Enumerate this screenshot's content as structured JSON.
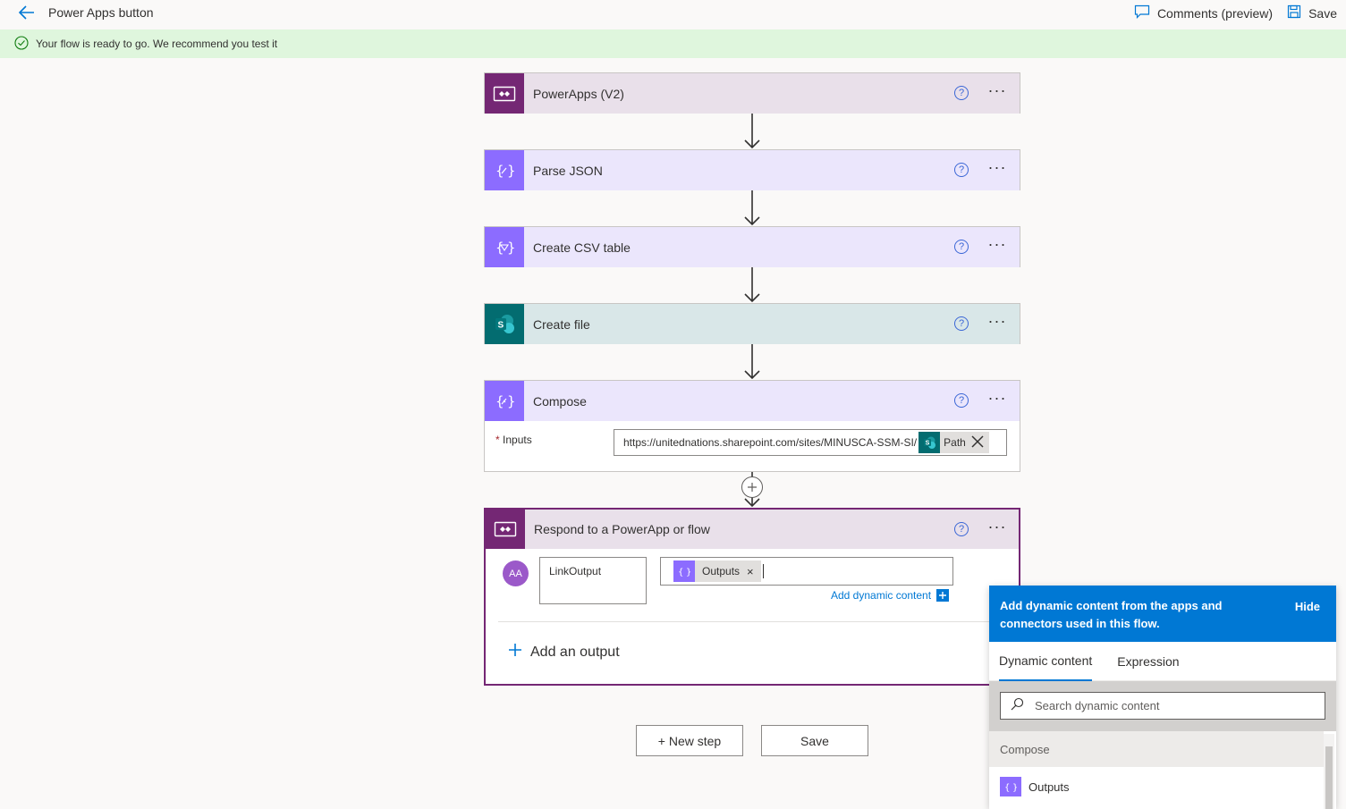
{
  "header": {
    "title": "Power Apps button",
    "comments_label": "Comments (preview)",
    "save_label": "Save"
  },
  "banner": {
    "message": "Your flow is ready to go. We recommend you test it"
  },
  "steps": [
    {
      "title": "PowerApps (V2)",
      "icon": "powerapps-icon",
      "color": "#742774",
      "head_bg": "#e9e0ea"
    },
    {
      "title": "Parse JSON",
      "icon": "data-operation-icon",
      "color": "#8c6cff",
      "head_bg": "#ebe6fc"
    },
    {
      "title": "Create CSV table",
      "icon": "data-operation-icon",
      "color": "#8c6cff",
      "head_bg": "#ebe6fc"
    },
    {
      "title": "Create file",
      "icon": "sharepoint-icon",
      "color": "#036c70",
      "head_bg": "#d9e7e8"
    },
    {
      "title": "Compose",
      "icon": "compose-icon",
      "color": "#8c6cff",
      "head_bg": "#ebe6fc"
    },
    {
      "title": "Respond to a PowerApp or flow",
      "icon": "powerapps-icon",
      "color": "#742774",
      "head_bg": "#e9e0ea"
    }
  ],
  "compose": {
    "inputs_label": "Inputs",
    "inputs_value": "https://unitednations.sharepoint.com/sites/MINUSCA-SSM-SI/",
    "token_label": "Path"
  },
  "respond": {
    "avatar_text": "AA",
    "output_name": "LinkOutput",
    "output_token": "Outputs",
    "add_dynamic_label": "Add dynamic content",
    "add_output_label": "Add an output"
  },
  "footer": {
    "new_step_label": "+ New step",
    "save_label": "Save"
  },
  "dynamic_panel": {
    "description": "Add dynamic content from the apps and connectors used in this flow.",
    "hide_label": "Hide",
    "tabs": [
      "Dynamic content",
      "Expression"
    ],
    "search_placeholder": "Search dynamic content",
    "group_label": "Compose",
    "item_label": "Outputs"
  },
  "colors": {
    "accent": "#0078d4",
    "banner": "#dff6dd",
    "powerapps": "#742774",
    "data_operation": "#8c6cff",
    "sharepoint": "#036c70"
  }
}
